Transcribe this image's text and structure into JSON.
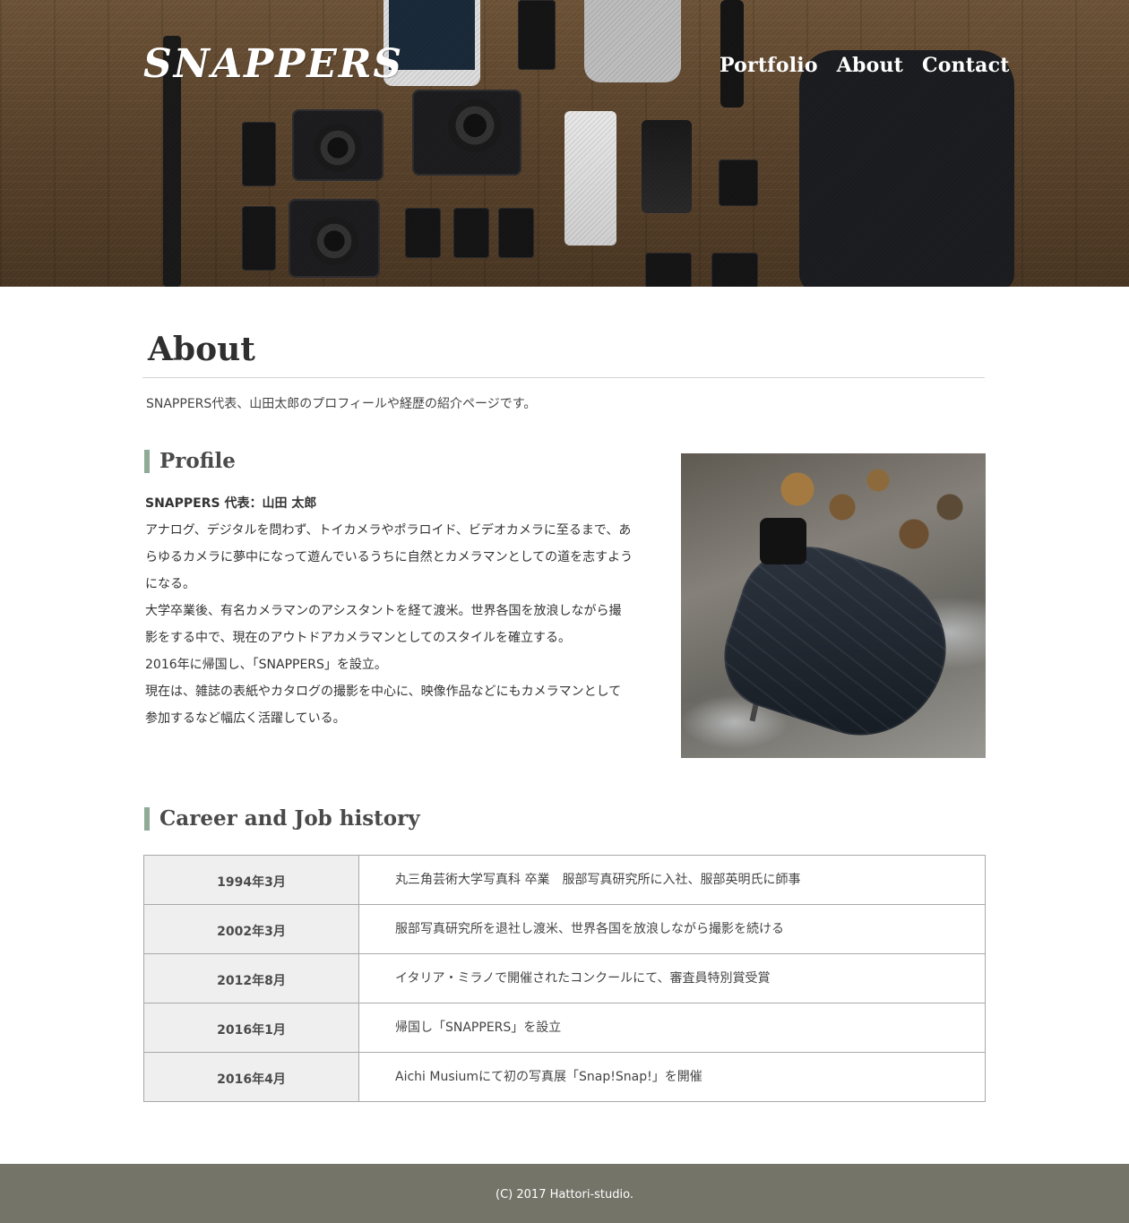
{
  "header": {
    "logo_text": "SNAPPERS",
    "nav": [
      {
        "label": "Portfolio"
      },
      {
        "label": "About"
      },
      {
        "label": "Contact"
      }
    ]
  },
  "main": {
    "title": "About",
    "intro": "SNAPPERS代表、山田太郎のプロフィールや経歴の紹介ページです。",
    "profile": {
      "heading": "Profile",
      "name": "SNAPPERS 代表：山田 太郎",
      "paragraphs": [
        "アナログ、デジタルを問わず、トイカメラやポラロイド、ビデオカメラに至るまで、あらゆるカメラに夢中になって遊んでいるうちに自然とカメラマンとしての道を志すようになる。",
        "大学卒業後、有名カメラマンのアシスタントを経て渡米。世界各国を放浪しながら撮影をする中で、現在のアウトドアカメラマンとしてのスタイルを確立する。",
        "2016年に帰国し、「SNAPPERS」を設立。",
        "現在は、雑誌の表紙やカタログの撮影を中心に、映像作品などにもカメラマンとして参加するなど幅広く活躍している。"
      ]
    },
    "career": {
      "heading": "Career and Job history",
      "rows": [
        {
          "date": "1994年3月",
          "text": "丸三角芸術大学写真科 卒業　服部写真研究所に入社、服部英明氏に師事"
        },
        {
          "date": "2002年3月",
          "text": "服部写真研究所を退社し渡米、世界各国を放浪しながら撮影を続ける"
        },
        {
          "date": "2012年8月",
          "text": "イタリア・ミラノで開催されたコンクールにて、審査員特別賞受賞"
        },
        {
          "date": "2016年1月",
          "text": "帰国し「SNAPPERS」を設立"
        },
        {
          "date": "2016年4月",
          "text": "Aichi Musiumにて初の写真展「Snap!Snap!」を開催"
        }
      ]
    }
  },
  "footer": {
    "copyright": "(C) 2017 Hattori-studio."
  },
  "colors": {
    "accent_bar": "#8faa97",
    "footer_bg": "#747469",
    "table_date_bg": "#efefef"
  }
}
